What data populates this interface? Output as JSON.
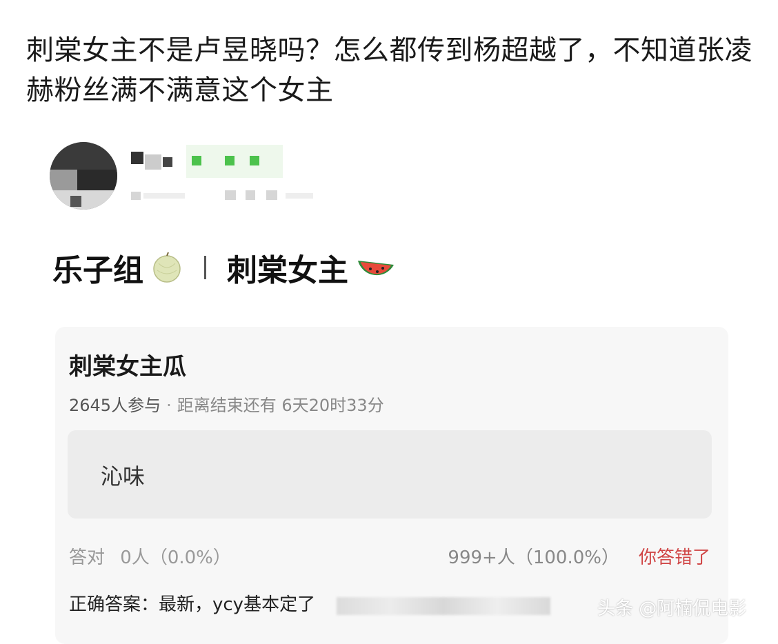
{
  "post": {
    "headline": "刺棠女主不是卢昱晓吗？怎么都传到杨超越了，不知道张凌赫粉丝满不满意这个女主"
  },
  "embedded": {
    "title_part1": "乐子组",
    "title_part2": "刺棠女主",
    "emoji1": "melon-icon",
    "emoji2": "watermelon-icon"
  },
  "quiz": {
    "title": "刺棠女主瓜",
    "participants": "2645人参与",
    "dot": "·",
    "countdown": "距离结束还有 6天20时33分",
    "option": "沁味",
    "correct_label": "答对",
    "correct_count": "0人（0.0%）",
    "chosen_count": "999+人（100.0%）",
    "wrong_label": "你答错了",
    "answer_text": "正确答案：最新，ycy基本定了"
  },
  "watermark": "头条 @阿楠侃电影",
  "colors": {
    "wrong_red": "#d04545",
    "card_bg": "#f7f7f7",
    "option_bg": "#ececec"
  }
}
